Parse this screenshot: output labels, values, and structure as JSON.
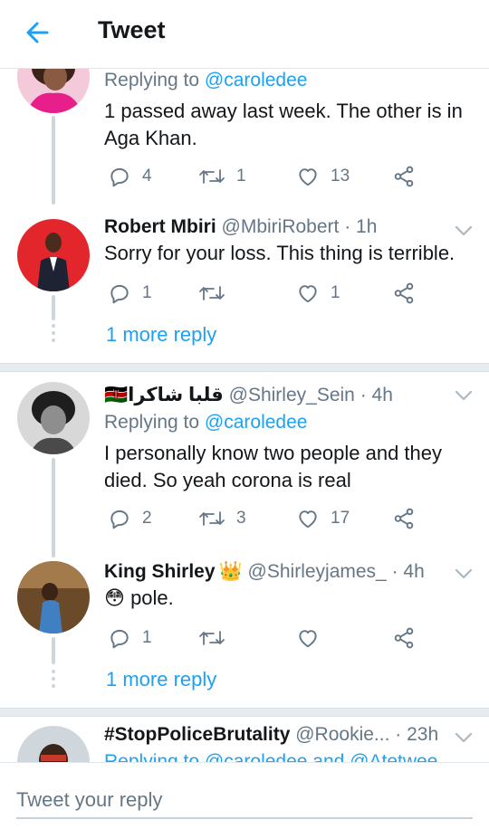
{
  "header": {
    "title": "Tweet",
    "back_icon": "arrow-left-icon"
  },
  "colors": {
    "accent": "#1da1f2",
    "secondary_text": "#657786"
  },
  "tweets": [
    {
      "name": "",
      "handle": "",
      "time": "",
      "replying_label": "Replying to",
      "replying_to": "@caroledee",
      "text": "1 passed away last week. The other is in Aga Khan.",
      "replies": "4",
      "retweets": "1",
      "likes": "13"
    },
    {
      "name": "Robert Mbiri",
      "handle": "@MbiriRobert",
      "time": "· 1h",
      "text": "Sorry for your loss. This thing is terrible.",
      "replies": "1",
      "retweets": "",
      "likes": "1",
      "more_replies": "1 more reply"
    },
    {
      "name": "قلبا شاكرا",
      "flag": "🇰🇪",
      "handle": "@Shirley_Sein",
      "time": "· 4h",
      "replying_label": "Replying to",
      "replying_to": "@caroledee",
      "text": "I personally know two people and they died. So yeah corona is real",
      "replies": "2",
      "retweets": "3",
      "likes": "17"
    },
    {
      "name": "King Shirley",
      "crown": "👑",
      "handle": "@Shirleyjames_",
      "time": "· 4h",
      "emoji": "😳",
      "text": "pole.",
      "replies": "1",
      "retweets": "",
      "likes": "",
      "more_replies": "1 more reply"
    },
    {
      "name": "#StopPoliceBrutality",
      "handle": "@Rookie...",
      "time": "· 23h",
      "replying_text": "Replying to @caroledee and @Atetwee"
    }
  ],
  "reply_bar": {
    "placeholder": "Tweet your reply"
  }
}
